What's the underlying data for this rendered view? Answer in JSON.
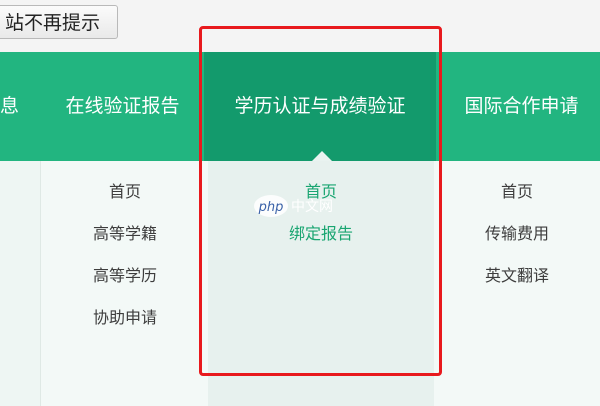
{
  "top_button": {
    "label": "站不再提示"
  },
  "nav": {
    "items": [
      {
        "label": "息"
      },
      {
        "label": "在线验证报告"
      },
      {
        "label": "学历认证与成绩验证"
      },
      {
        "label": "国际合作申请"
      }
    ]
  },
  "dropdowns": {
    "col1": [
      "首页",
      "高等学籍",
      "高等学历",
      "协助申请"
    ],
    "col2": [
      "首页",
      "绑定报告"
    ],
    "col3": [
      "首页",
      "传输费用",
      "英文翻译"
    ]
  },
  "watermark": {
    "left": "php",
    "right": "中文网"
  },
  "colors": {
    "nav_bg": "#22b580",
    "nav_active_bg": "#139a6c",
    "link_green": "#19a571",
    "highlight_red": "#e8191d"
  }
}
